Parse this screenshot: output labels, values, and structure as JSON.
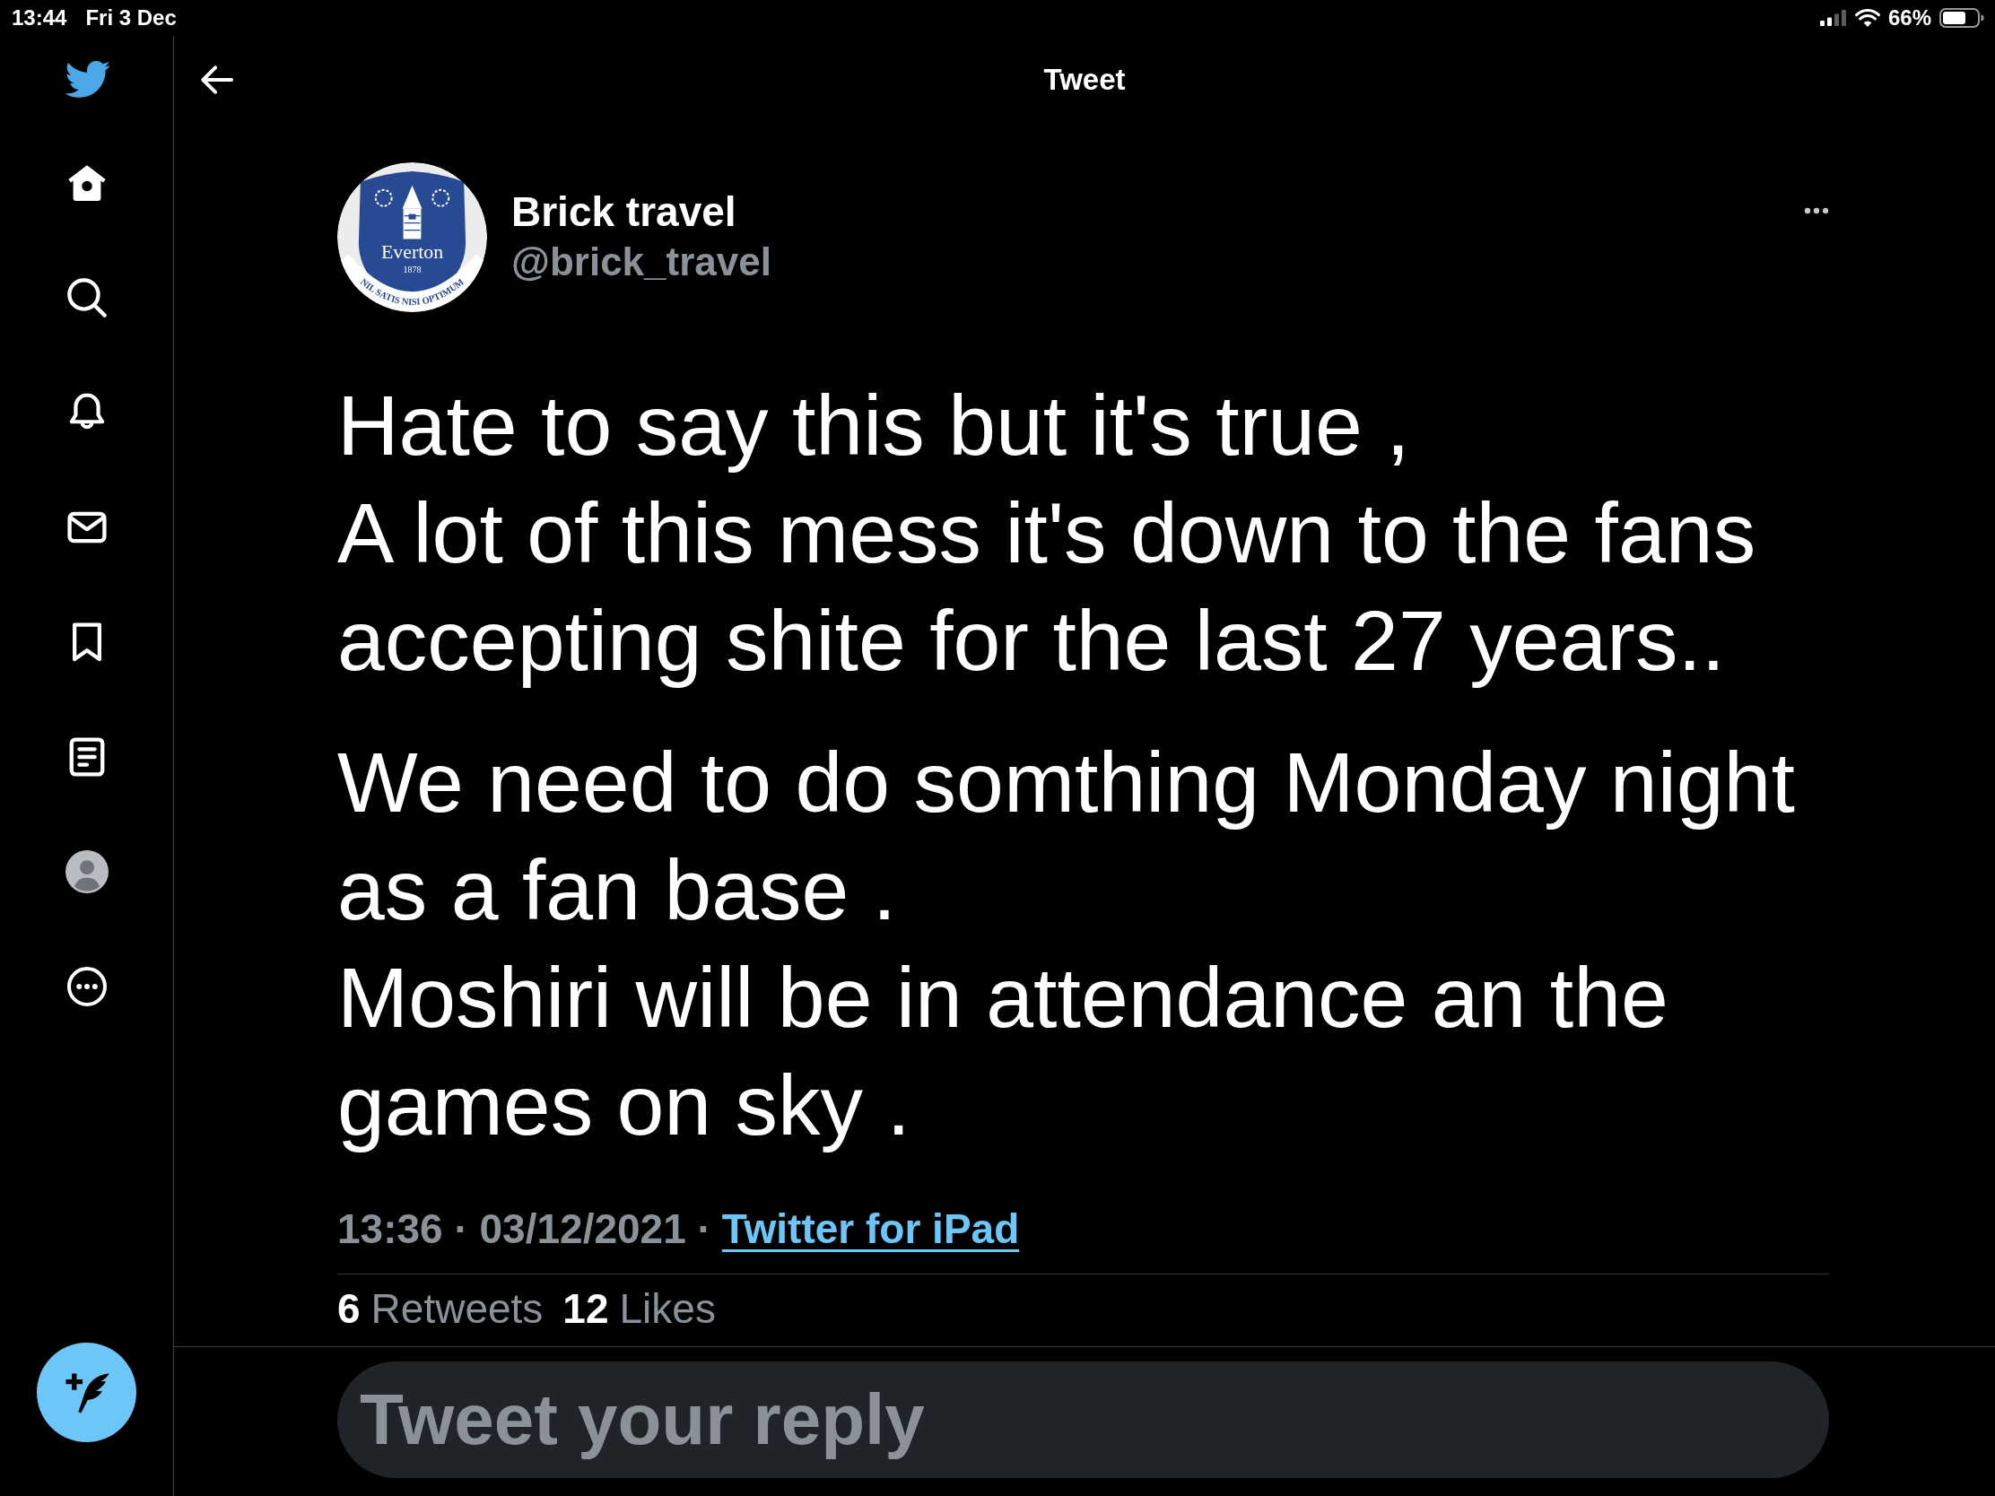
{
  "status_bar": {
    "time": "13:44",
    "date": "Fri 3 Dec",
    "battery": "66%"
  },
  "sidebar": {
    "items": [
      {
        "kind": "home",
        "selected": true
      },
      {
        "kind": "explore",
        "selected": false
      },
      {
        "kind": "notifications",
        "selected": false
      },
      {
        "kind": "messages",
        "selected": false
      },
      {
        "kind": "bookmarks",
        "selected": false
      },
      {
        "kind": "lists",
        "selected": false
      },
      {
        "kind": "profile",
        "selected": false
      },
      {
        "kind": "more",
        "selected": false
      }
    ]
  },
  "header": {
    "title": "Tweet"
  },
  "tweet": {
    "author": {
      "name": "Brick travel",
      "handle": "@brick_travel",
      "avatar": {
        "name": "Everton",
        "year": "1878",
        "motto": "NIL SATIS NISI OPTIMUM"
      }
    },
    "paragraphs": [
      "Hate to say this but it's true ,\nA lot of this mess it's down to the fans accepting shite for the last 27 years..",
      "We need to do somthing Monday night as a fan base .\nMoshiri will be in attendance an the games on sky ."
    ],
    "timestamp": "13:36 · 03/12/2021 ·",
    "source": "Twitter for iPad",
    "stats": [
      {
        "count": "6",
        "label": "Retweets"
      },
      {
        "count": "12",
        "label": "Likes"
      }
    ]
  },
  "reply": {
    "placeholder": "Tweet your reply"
  }
}
